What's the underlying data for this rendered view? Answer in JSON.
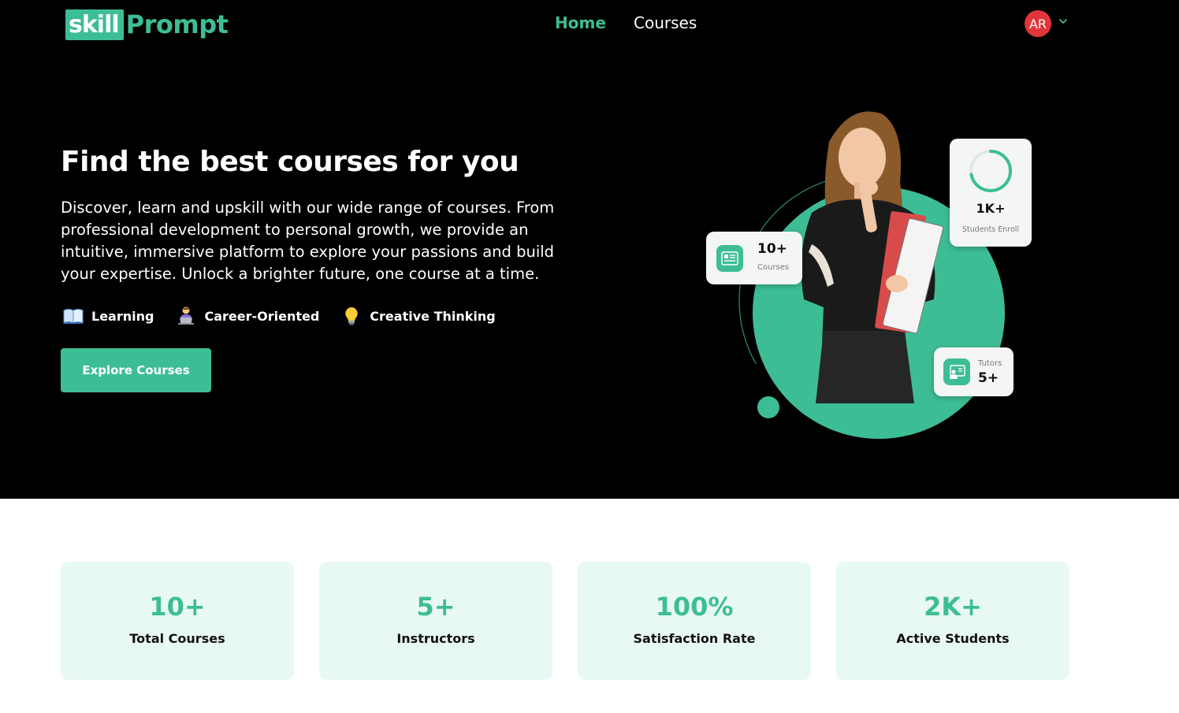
{
  "brand": {
    "logo_part1": "skill",
    "logo_part2": "Prompt",
    "accent": "#3dbd96"
  },
  "nav": {
    "home": "Home",
    "courses": "Courses"
  },
  "user": {
    "initials": "AR",
    "avatar_color": "#e0363b"
  },
  "hero": {
    "title": "Find the best courses for you",
    "description": "Discover, learn and upskill with our wide range of courses. From professional development to personal growth, we provide an intuitive, immersive platform to explore your passions and build your expertise. Unlock a brighter future, one course at a time.",
    "tags": [
      {
        "icon": "book-icon",
        "label": "Learning"
      },
      {
        "icon": "person-laptop-icon",
        "label": "Career-Oriented"
      },
      {
        "icon": "lightbulb-icon",
        "label": "Creative Thinking"
      }
    ],
    "cta": "Explore Courses"
  },
  "illustration": {
    "courses_card": {
      "value": "10+",
      "label": "Courses"
    },
    "students_card": {
      "value": "1K+",
      "label": "Students Enroll",
      "progress": 0.72
    },
    "tutors_card": {
      "label": "Tutors",
      "value": "5+"
    }
  },
  "stats": [
    {
      "value": "10+",
      "label": "Total Courses"
    },
    {
      "value": "5+",
      "label": "Instructors"
    },
    {
      "value": "100%",
      "label": "Satisfaction Rate"
    },
    {
      "value": "2K+",
      "label": "Active Students"
    }
  ]
}
